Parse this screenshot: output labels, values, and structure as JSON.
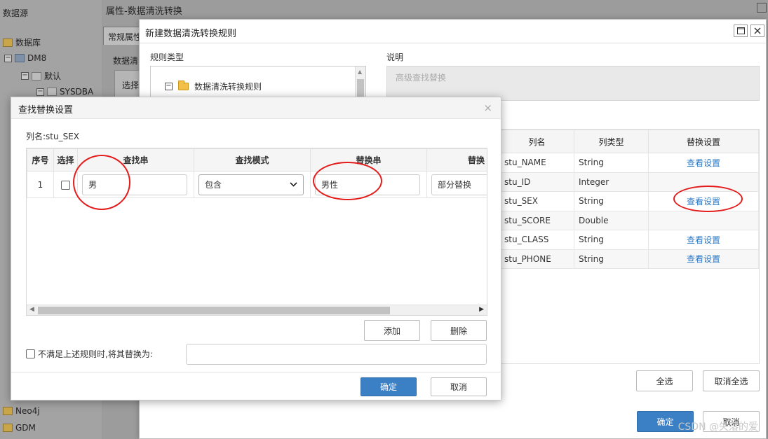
{
  "datasource_tree": {
    "title": "数据源",
    "items": [
      "数据库",
      "DM8",
      "默认",
      "SYSDBA",
      "Neo4j",
      "GDM"
    ]
  },
  "properties_window": {
    "title": "属性-数据清洗转换",
    "tab": "常规属性",
    "label": "数据清",
    "select_label": "选择"
  },
  "rule_window": {
    "title": "新建数据清洗转换规则",
    "rule_type_label": "规则类型",
    "tree_node": "数据清洗转换规则",
    "desc_label": "说明",
    "desc_text": "高级查找替换",
    "columns": {
      "headers": [
        "列名",
        "列类型",
        "替换设置"
      ],
      "rows": [
        {
          "name": "stu_NAME",
          "type": "String",
          "setting": "查看设置"
        },
        {
          "name": "stu_ID",
          "type": "Integer",
          "setting": ""
        },
        {
          "name": "stu_SEX",
          "type": "String",
          "setting": "查看设置"
        },
        {
          "name": "stu_SCORE",
          "type": "Double",
          "setting": ""
        },
        {
          "name": "stu_CLASS",
          "type": "String",
          "setting": "查看设置"
        },
        {
          "name": "stu_PHONE",
          "type": "String",
          "setting": "查看设置"
        }
      ]
    },
    "select_all": "全选",
    "deselect_all": "取消全选",
    "ok": "确定",
    "cancel": "取消"
  },
  "find_replace_dialog": {
    "title": "查找替换设置",
    "close_icon": "×",
    "column_name": "列名:stu_SEX",
    "headers": [
      "序号",
      "选择",
      "查找串",
      "查找模式",
      "替换串",
      "替换"
    ],
    "row": {
      "index": "1",
      "find": "男",
      "mode": "包含",
      "replace": "男性",
      "replace_mode": "部分替换"
    },
    "add": "添加",
    "delete": "删除",
    "else_label": "不满足上述规则时,将其替换为:",
    "else_value": "",
    "ok": "确定",
    "cancel": "取消"
  },
  "annotation_color": "#e41b1b",
  "watermark": "CSDN @失落的爱"
}
